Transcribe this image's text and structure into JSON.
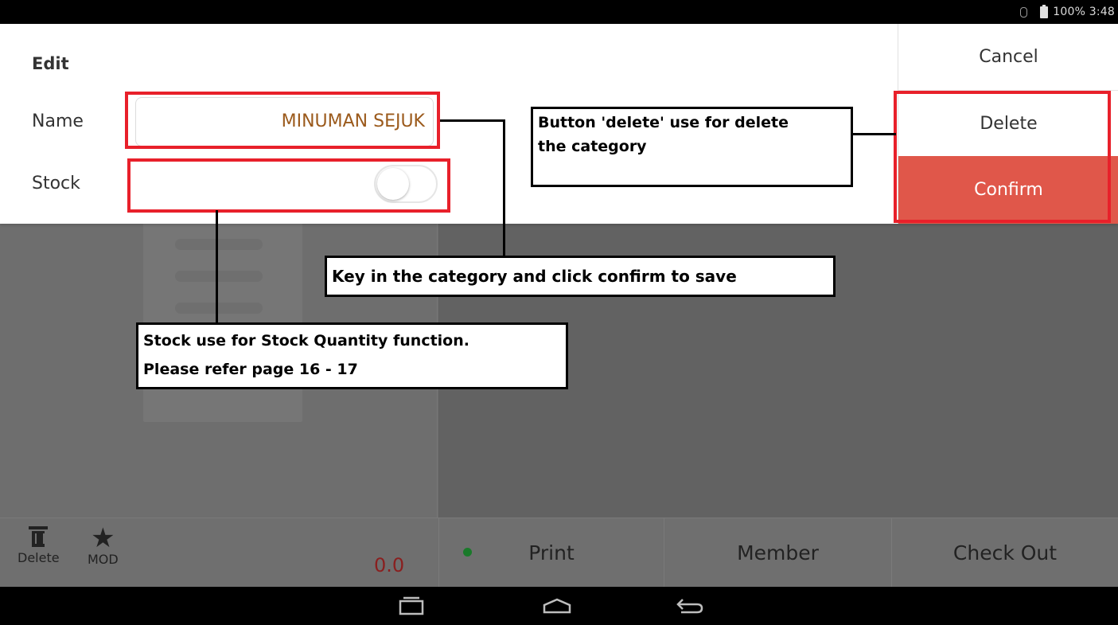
{
  "status_bar": {
    "battery_time": "100% 3:48"
  },
  "edit_panel": {
    "title": "Edit",
    "name_label": "Name",
    "name_value": "MINUMAN SEJUK",
    "stock_label": "Stock",
    "stock_toggle_on": false,
    "actions": {
      "cancel": "Cancel",
      "delete": "Delete",
      "confirm": "Confirm"
    }
  },
  "bottom_bar": {
    "delete_label": "Delete",
    "mod_label": "MOD",
    "total": "0.0",
    "print": "Print",
    "member": "Member",
    "check_out": "Check Out"
  },
  "annotations": {
    "delete_note_line1": "Button 'delete' use for delete",
    "delete_note_line2": "the category",
    "confirm_note": "Key in the category and click confirm to save",
    "stock_note_line1": "Stock use for Stock Quantity function.",
    "stock_note_line2": "Please refer page 16 - 17"
  },
  "colors": {
    "confirm_bg": "#e0574a",
    "annotation_red": "#e8202a",
    "name_text": "#9b5a1c",
    "total_text": "#8a1f1f",
    "print_dot": "#1a7a2a"
  },
  "icons": {
    "status": [
      "bluetooth-icon",
      "battery-icon"
    ],
    "bottom": [
      "trash-icon",
      "star-icon"
    ],
    "nav": [
      "recent-apps-icon",
      "home-icon",
      "back-icon"
    ]
  }
}
